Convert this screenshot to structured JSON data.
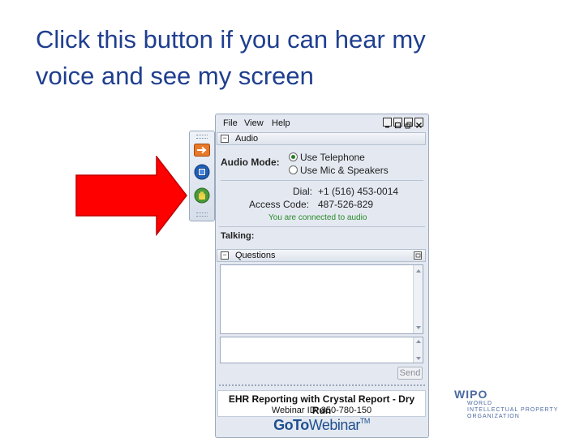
{
  "slide": {
    "title_line1": "Click this button if you can hear my",
    "title_line2": "voice and see my screen"
  },
  "colors": {
    "title": "#1f3f8f",
    "arrow": "#ff0000",
    "connected_text": "#2a8a2a",
    "brand": "#1f4f8f"
  },
  "toolbar": {
    "icons": [
      "arrow-right-icon",
      "screen-icon",
      "hand-raise-icon"
    ]
  },
  "menu": {
    "file": "File",
    "view": "View",
    "help": "Help"
  },
  "audio": {
    "section_title": "Audio",
    "mode_label": "Audio Mode:",
    "option_telephone": "Use Telephone",
    "option_mic": "Use Mic & Speakers",
    "selected_option": "Use Telephone",
    "dial_label": "Dial:",
    "dial_value": "+1 (516) 453-0014",
    "access_code_label": "Access Code:",
    "access_code_value": "487-526-829",
    "connected_text": "You are connected to audio",
    "talking_label": "Talking:"
  },
  "questions": {
    "section_title": "Questions",
    "send_label": "Send"
  },
  "webinar": {
    "title": "EHR Reporting with Crystal Report - Dry Run",
    "id_text": "Webinar ID: 850-780-150"
  },
  "brand": {
    "goto": "GoTo",
    "webinar": "Webinar",
    "tm": "TM"
  },
  "wipo": {
    "name": "WIPO",
    "line1": "WORLD",
    "line2": "INTELLECTUAL PROPERTY",
    "line3": "ORGANIZATION"
  }
}
